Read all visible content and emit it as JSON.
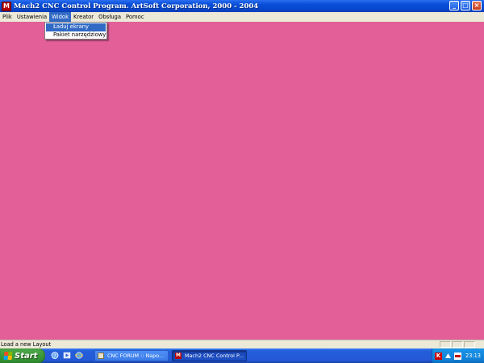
{
  "window": {
    "title": "Mach2 CNC Control Program. ArtSoft Corporation, 2000 - 2004",
    "icon_letter": "M",
    "minimize_glyph": "_",
    "maximize_glyph": "□",
    "close_glyph": "×"
  },
  "menubar": {
    "items": [
      "Plik",
      "Ustawienia",
      "Widok",
      "Kreator",
      "Obsługa",
      "Pomoc"
    ],
    "active_index": 2
  },
  "dropdown": {
    "items": [
      "Ładuj ekrany",
      "Pakiet narzędziowy"
    ],
    "highlighted_index": 0
  },
  "statusbar": {
    "text": "Load a new Layout"
  },
  "taskbar": {
    "start_label": "Start",
    "quicklaunch_icons": [
      "help-icon",
      "media-icon",
      "browser-icon"
    ],
    "tasks": [
      {
        "label": "CNC FORUM :: Napo...",
        "icon": "forum-window-icon"
      },
      {
        "label": "Mach2 CNC Control P...",
        "icon": "mach2-window-icon"
      }
    ],
    "tray": {
      "icons": [
        "k-tray-icon",
        "arrow-tray-icon",
        "ati-tray-icon"
      ],
      "k_letter": "K",
      "clock": "23:13"
    }
  },
  "colors": {
    "workspace": "#e35f98",
    "menu_highlight": "#316ac5",
    "titlebar": "#0848cf"
  }
}
